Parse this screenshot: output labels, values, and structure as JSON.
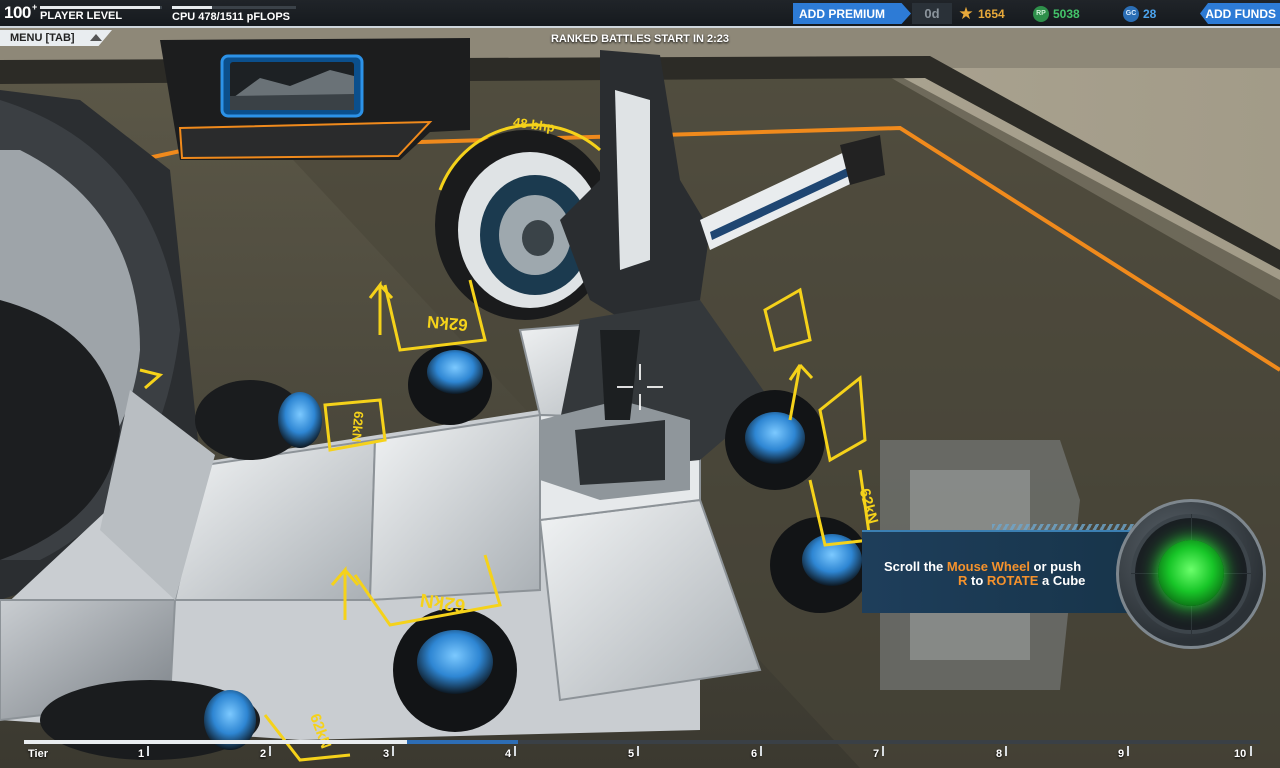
{
  "hud": {
    "player_level": "100",
    "player_level_sup": "+",
    "player_level_label": "PLAYER LEVEL",
    "player_level_progress": 0.98,
    "cpu_label": "CPU 478/1511 pFLOPS",
    "cpu_progress": 0.32,
    "add_premium_label": "ADD PREMIUM",
    "premium_days": "0d",
    "tech_points": "1654",
    "robot_points": "5038",
    "robot_points_icon_text": "RP",
    "galaxy_cash": "28",
    "galaxy_cash_icon_text": "GC",
    "add_funds_label": "ADD FUNDS",
    "menu_label": "MENU [TAB]",
    "ranked_label": "RANKED BATTLES START IN 2:23"
  },
  "scene": {
    "screen_label": "48 bhp",
    "thruster_labels": [
      "62kN",
      "62kN",
      "62kN",
      "62kN",
      "62kN",
      "62kN"
    ]
  },
  "tooltip": {
    "line1_pre": "Scroll the ",
    "line1_hl": "Mouse Wheel",
    "line1_post": " or push",
    "line2_key": "R",
    "line2_mid": " to ",
    "line2_hl": "ROTATE",
    "line2_post": " a Cube"
  },
  "tier_bar": {
    "label": "Tier",
    "ticks": [
      "1",
      "2",
      "3",
      "4",
      "5",
      "6",
      "7",
      "8",
      "9",
      "10"
    ],
    "progress": 0.31,
    "next_progress": 0.4
  },
  "colors": {
    "accent_blue": "#2d7bd6",
    "highlight_orange": "#f5922c",
    "overlay_yellow": "#f5d21a",
    "ready_green": "#18c628"
  }
}
